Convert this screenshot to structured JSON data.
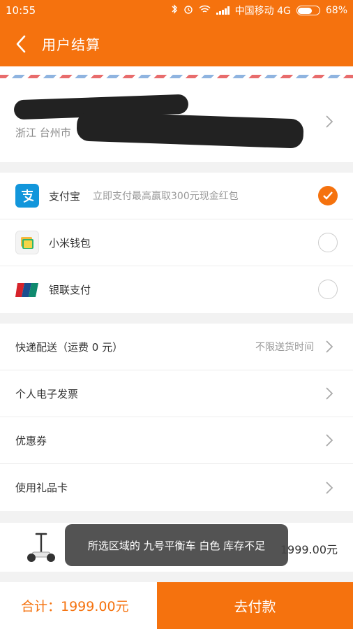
{
  "status_bar": {
    "time": "10:55",
    "carrier": "中国移动 4G",
    "battery": "68%"
  },
  "header": {
    "title": "用户结算"
  },
  "address": {
    "city": "浙江 台州市"
  },
  "payment": {
    "methods": [
      {
        "label": "支付宝",
        "promo": "立即支付最高赢取300元现金红包",
        "selected": true
      },
      {
        "label": "小米钱包",
        "selected": false
      },
      {
        "label": "银联支付",
        "selected": false
      }
    ]
  },
  "options": {
    "delivery": {
      "label": "快递配送（运费 0 元）",
      "value": "不限送货时间"
    },
    "invoice": {
      "label": "个人电子发票"
    },
    "coupon": {
      "label": "优惠券"
    },
    "gift_card": {
      "label": "使用礼品卡"
    }
  },
  "product": {
    "price": "1999.00元"
  },
  "toast": {
    "message": "所选区域的 九号平衡车 白色 库存不足"
  },
  "footer": {
    "total": "合计：1999.00元",
    "pay_label": "去付款"
  },
  "colors": {
    "accent": "#f5720e",
    "background": "#f2f2f2"
  }
}
